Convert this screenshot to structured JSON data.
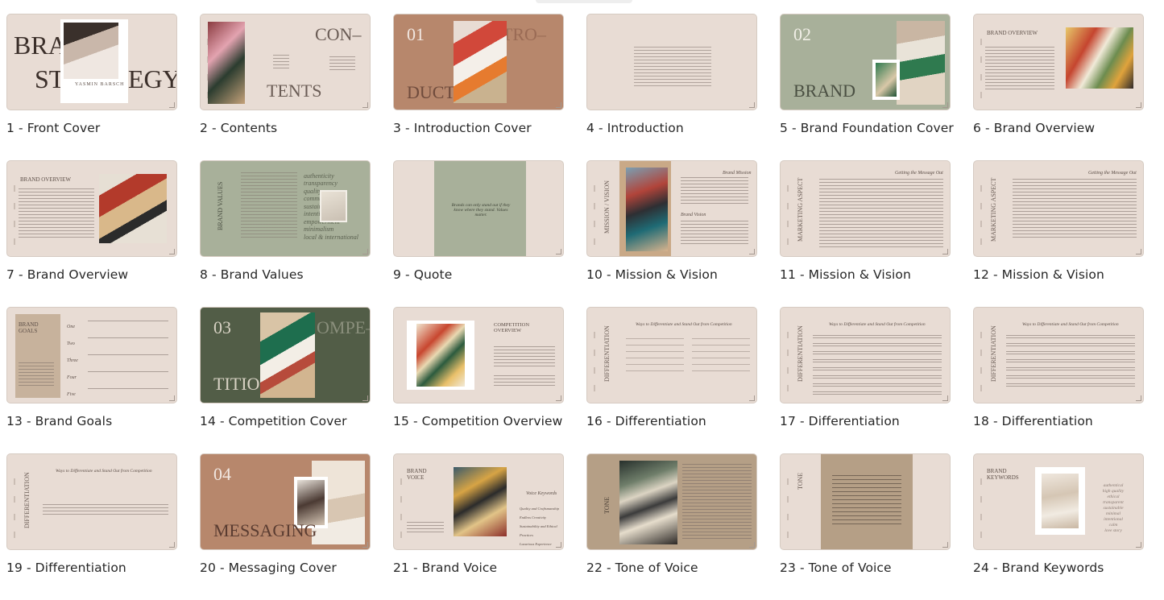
{
  "slides": [
    {
      "n": "1",
      "title": "Front Cover",
      "label": "1 - Front Cover",
      "big": "BRAND STRATEGY",
      "name": "YASMIN BARSCH"
    },
    {
      "n": "2",
      "title": "Contents",
      "label": "2 - Contents",
      "big": "CON– TENTS"
    },
    {
      "n": "3",
      "title": "Introduction Cover",
      "label": "3 - Introduction Cover",
      "num": "01",
      "big": "INTRO– DUCTION"
    },
    {
      "n": "4",
      "title": "Introduction",
      "label": "4 - Introduction"
    },
    {
      "n": "5",
      "title": "Brand Foundation Cover",
      "label": "5 - Brand Foundation Cover",
      "num": "02",
      "big": "BRAND"
    },
    {
      "n": "6",
      "title": "Brand Overview",
      "label": "6 - Brand Overview",
      "heading": "BRAND OVERVIEW"
    },
    {
      "n": "7",
      "title": "Brand Overview",
      "label": "7 - Brand Overview",
      "heading": "BRAND OVERVIEW"
    },
    {
      "n": "8",
      "title": "Brand Values",
      "label": "8 - Brand Values",
      "heading": "BRAND VALUES",
      "values": [
        "authenticity",
        "transparency",
        "quality",
        "community",
        "sustainability",
        "intentional",
        "empowerment",
        "minimalism",
        "local & international"
      ]
    },
    {
      "n": "9",
      "title": "Quote",
      "label": "9 - Quote",
      "quote": "Brands can only stand out if they know where they stand. Values matter."
    },
    {
      "n": "10",
      "title": "Mission & Vision",
      "label": "10 - Mission & Vision",
      "heading": "MISSION / VISION",
      "sub1": "Brand Mission",
      "sub2": "Brand Vision"
    },
    {
      "n": "11",
      "title": "Mission & Vision",
      "label": "11 - Mission & Vision",
      "heading": "MARKETING ASPECT",
      "sub1": "Getting the Message Out"
    },
    {
      "n": "12",
      "title": "Mission & Vision",
      "label": "12 - Mission & Vision",
      "heading": "MARKETING ASPECT",
      "sub1": "Getting the Message Out"
    },
    {
      "n": "13",
      "title": "Brand Goals",
      "label": "13 - Brand Goals",
      "heading": "BRAND GOALS",
      "goals": [
        "One",
        "Two",
        "Three",
        "Four",
        "Five"
      ]
    },
    {
      "n": "14",
      "title": "Competition Cover",
      "label": "14 - Competition Cover",
      "num": "03",
      "big": "COMPE– TITION"
    },
    {
      "n": "15",
      "title": "Competition Overview",
      "label": "15 - Competition Overview",
      "heading": "COMPETITION OVERVIEW"
    },
    {
      "n": "16",
      "title": "Differentiation",
      "label": "16 - Differentiation",
      "heading": "DIFFERENTIATION",
      "sub1": "Ways to Differentiate and Stand Out from Competition"
    },
    {
      "n": "17",
      "title": "Differentiation",
      "label": "17 - Differentiation",
      "heading": "DIFFERENTIATION",
      "sub1": "Ways to Differentiate and Stand Out from Competition"
    },
    {
      "n": "18",
      "title": "Differentiation",
      "label": "18 - Differentiation",
      "heading": "DIFFERENTIATION",
      "sub1": "Ways to Differentiate and Stand Out from Competition"
    },
    {
      "n": "19",
      "title": "Differentiation",
      "label": "19 - Differentiation",
      "heading": "DIFFERENTIATION",
      "sub1": "Ways to Differentiate and Stand Out from Competition"
    },
    {
      "n": "20",
      "title": "Messaging Cover",
      "label": "20 - Messaging Cover",
      "num": "04",
      "big": "MESSAGING"
    },
    {
      "n": "21",
      "title": "Brand Voice",
      "label": "21 - Brand Voice",
      "heading": "BRAND VOICE",
      "sub1": "Voice Keywords",
      "keywords": [
        "Quality and Craftsmanship",
        "Endless Creativity",
        "Sustainability and Ethical Practices",
        "Luxurious Experience"
      ]
    },
    {
      "n": "22",
      "title": "Tone of Voice",
      "label": "22 - Tone of Voice",
      "heading": "TONE"
    },
    {
      "n": "23",
      "title": "Tone of Voice",
      "label": "23 - Tone of Voice",
      "heading": "TONE"
    },
    {
      "n": "24",
      "title": "Brand Keywords",
      "label": "24 - Brand Keywords",
      "heading": "BRAND KEYWORDS",
      "keywords": [
        "authentical",
        "high quality",
        "ethical",
        "transparent",
        "sustainable",
        "minimal",
        "intentional",
        "calm",
        "love story"
      ]
    }
  ],
  "colors": {
    "beige": "#e8dcd4",
    "sage": "#a8b09a",
    "terracotta": "#b7876c",
    "olive": "#525d47",
    "tan": "#b59f86"
  }
}
